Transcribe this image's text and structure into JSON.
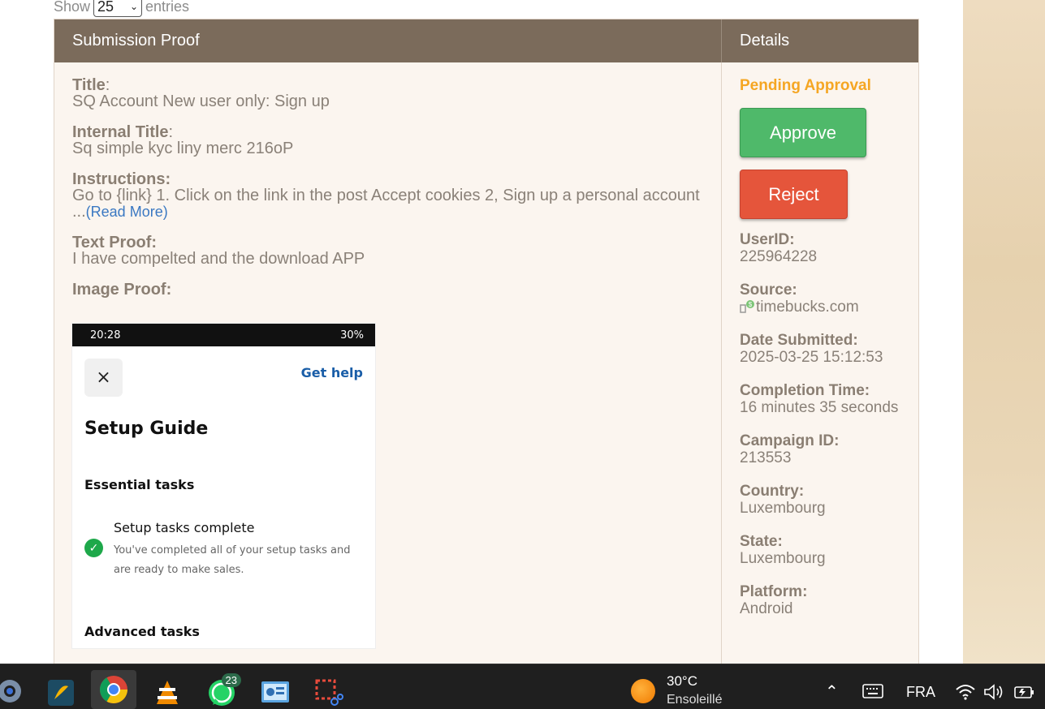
{
  "table_controls": {
    "show_label": "Show",
    "entries_value": "25",
    "entries_label": "entries"
  },
  "table": {
    "headers": {
      "proof": "Submission Proof",
      "details": "Details"
    }
  },
  "proof": {
    "title_label": "Title",
    "title_value": "SQ Account New user only: Sign up",
    "internal_title_label": "Internal Title",
    "internal_title_value": "Sq simple kyc liny merc 216oP",
    "instructions_label": "Instructions:",
    "instructions_value": "Go to {link} 1. Click on the link in the post Accept cookies 2, Sign up a personal account ...",
    "read_more": "(Read More)",
    "text_proof_label": "Text Proof:",
    "text_proof_value": "I have compelted and the download APP",
    "image_proof_label": "Image Proof:",
    "screenshot": {
      "time": "20:28",
      "battery": "30%",
      "close": "×",
      "get_help": "Get help",
      "title": "Setup Guide",
      "essential": "Essential tasks",
      "task_title": "Setup tasks complete",
      "task_desc": "You've completed all of your setup tasks and are ready to make sales.",
      "advanced": "Advanced tasks"
    }
  },
  "details": {
    "status": "Pending Approval",
    "approve": "Approve",
    "reject": "Reject",
    "userid_label": "UserID:",
    "userid_value": "225964228",
    "source_label": "Source:",
    "source_value": "timebucks.com",
    "date_label": "Date Submitted:",
    "date_value": "2025-03-25 15:12:53",
    "completion_label": "Completion Time:",
    "completion_value": "16 minutes 35 seconds",
    "campaign_label": "Campaign ID:",
    "campaign_value": "213553",
    "country_label": "Country:",
    "country_value": "Luxembourg",
    "state_label": "State:",
    "state_value": "Luxembourg",
    "platform_label": "Platform:",
    "platform_value": "Android"
  },
  "taskbar": {
    "whatsapp_badge": "23",
    "weather_temp": "30°C",
    "weather_desc": "Ensoleillé",
    "language": "FRA",
    "icons": [
      "settings-icon",
      "app-icon",
      "chrome-icon",
      "vlc-icon",
      "whatsapp-icon",
      "control-panel-icon",
      "snipping-tool-icon"
    ]
  },
  "colors": {
    "header_bg": "#7b6b5b",
    "pending": "#f5a623",
    "approve": "#4fb96a",
    "reject": "#e5553b",
    "link": "#3a78c2"
  }
}
